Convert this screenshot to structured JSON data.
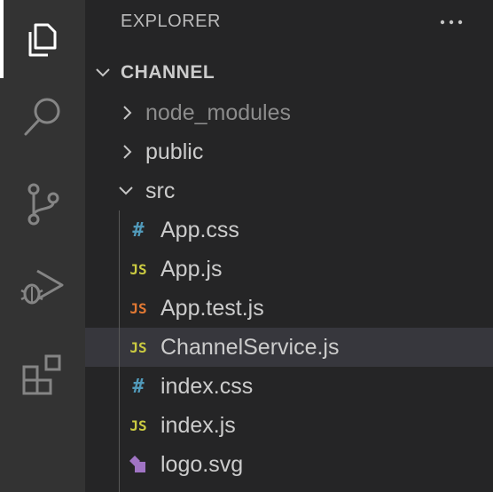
{
  "explorer": {
    "title": "EXPLORER",
    "more_actions_icon": "ellipsis-icon"
  },
  "activity_bar": {
    "items": [
      {
        "name": "files-icon",
        "active": true
      },
      {
        "name": "search-icon",
        "active": false
      },
      {
        "name": "source-control-icon",
        "active": false
      },
      {
        "name": "run-debug-icon",
        "active": false
      },
      {
        "name": "extensions-icon",
        "active": false
      }
    ]
  },
  "tree": {
    "root": {
      "label": "CHANNEL",
      "expanded": true
    },
    "folders": [
      {
        "label": "node_modules",
        "expanded": false,
        "dimmed": true
      },
      {
        "label": "public",
        "expanded": false
      },
      {
        "label": "src",
        "expanded": true
      }
    ],
    "files": [
      {
        "label": "App.css",
        "icon": "css-icon",
        "badge": "#"
      },
      {
        "label": "App.js",
        "icon": "js-icon",
        "badge": "JS"
      },
      {
        "label": "App.test.js",
        "icon": "js-test-icon",
        "badge": "JS"
      },
      {
        "label": "ChannelService.js",
        "icon": "js-icon",
        "badge": "JS",
        "selected": true
      },
      {
        "label": "index.css",
        "icon": "css-icon",
        "badge": "#"
      },
      {
        "label": "index.js",
        "icon": "js-icon",
        "badge": "JS"
      },
      {
        "label": "logo.svg",
        "icon": "svg-icon"
      }
    ]
  },
  "colors": {
    "activity_bar": "#333333",
    "sidebar": "#252526",
    "selected_row": "#37373d",
    "js": "#cbcb41",
    "js_test": "#e37933",
    "css": "#519aba",
    "svg": "#a074c4"
  }
}
